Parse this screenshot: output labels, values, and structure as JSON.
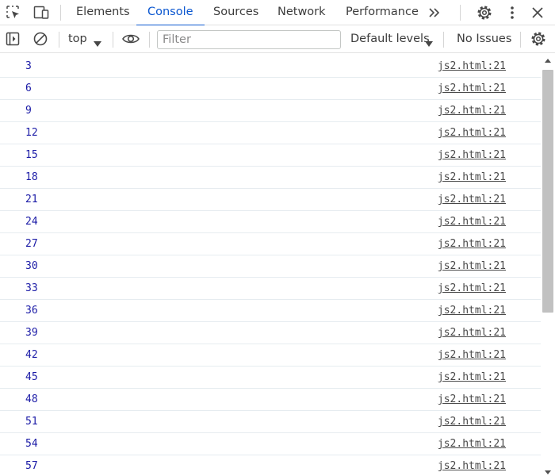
{
  "tabs": [
    {
      "label": "Elements",
      "active": false
    },
    {
      "label": "Console",
      "active": true
    },
    {
      "label": "Sources",
      "active": false
    },
    {
      "label": "Network",
      "active": false
    },
    {
      "label": "Performance",
      "active": false
    }
  ],
  "toolbar": {
    "context": "top",
    "filter_placeholder": "Filter",
    "levels": "Default levels",
    "issues": "No Issues"
  },
  "console": {
    "messages": [
      {
        "value": "3",
        "source": "js2.html:21"
      },
      {
        "value": "6",
        "source": "js2.html:21"
      },
      {
        "value": "9",
        "source": "js2.html:21"
      },
      {
        "value": "12",
        "source": "js2.html:21"
      },
      {
        "value": "15",
        "source": "js2.html:21"
      },
      {
        "value": "18",
        "source": "js2.html:21"
      },
      {
        "value": "21",
        "source": "js2.html:21"
      },
      {
        "value": "24",
        "source": "js2.html:21"
      },
      {
        "value": "27",
        "source": "js2.html:21"
      },
      {
        "value": "30",
        "source": "js2.html:21"
      },
      {
        "value": "33",
        "source": "js2.html:21"
      },
      {
        "value": "36",
        "source": "js2.html:21"
      },
      {
        "value": "39",
        "source": "js2.html:21"
      },
      {
        "value": "42",
        "source": "js2.html:21"
      },
      {
        "value": "45",
        "source": "js2.html:21"
      },
      {
        "value": "48",
        "source": "js2.html:21"
      },
      {
        "value": "51",
        "source": "js2.html:21"
      },
      {
        "value": "54",
        "source": "js2.html:21"
      },
      {
        "value": "57",
        "source": "js2.html:21"
      }
    ]
  },
  "colors": {
    "accent": "#0b57d0",
    "value_text": "#1a1aa6",
    "link_text": "#474747",
    "row_divider": "#e6ecf0"
  },
  "icons": {
    "inspect": "inspect-element-icon",
    "device": "device-toolbar-icon",
    "more_tabs": "more-tabs-chevron-icon",
    "settings": "gear-icon",
    "menu": "more-vertical-icon",
    "close": "close-icon",
    "sidebar": "sidebar-toggle-icon",
    "clear": "clear-console-icon",
    "eye": "live-expression-eye-icon",
    "console_settings": "console-settings-gear-icon"
  }
}
